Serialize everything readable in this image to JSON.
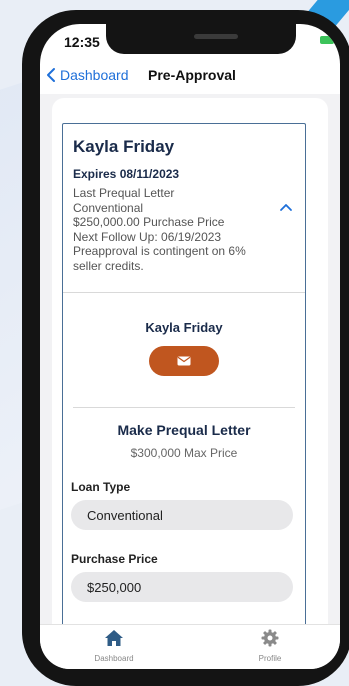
{
  "status": {
    "time": "12:35"
  },
  "nav": {
    "back_label": "Dashboard",
    "title": "Pre-Approval"
  },
  "client": {
    "name": "Kayla Friday",
    "expires": "Expires 08/11/2023",
    "info_lines": [
      "Last Prequal Letter",
      "Conventional",
      "$250,000.00 Purchase Price",
      "Next Follow Up: 06/19/2023",
      "Preapproval is contingent on 6%",
      "seller credits."
    ]
  },
  "contact": {
    "name": "Kayla Friday"
  },
  "prequal": {
    "title": "Make Prequal Letter",
    "max_price": "$300,000 Max Price",
    "loan_type_label": "Loan Type",
    "loan_type_value": "Conventional",
    "purchase_price_label": "Purchase Price",
    "purchase_price_value": "$250,000"
  },
  "tabs": [
    {
      "label": "Dashboard",
      "icon": "home-icon"
    },
    {
      "label": "Profile",
      "icon": "gear-icon"
    }
  ],
  "colors": {
    "accent": "#1e6fd9",
    "email_button": "#c0561f",
    "card_border": "#4a6f96",
    "home_icon": "#2f5c86"
  }
}
